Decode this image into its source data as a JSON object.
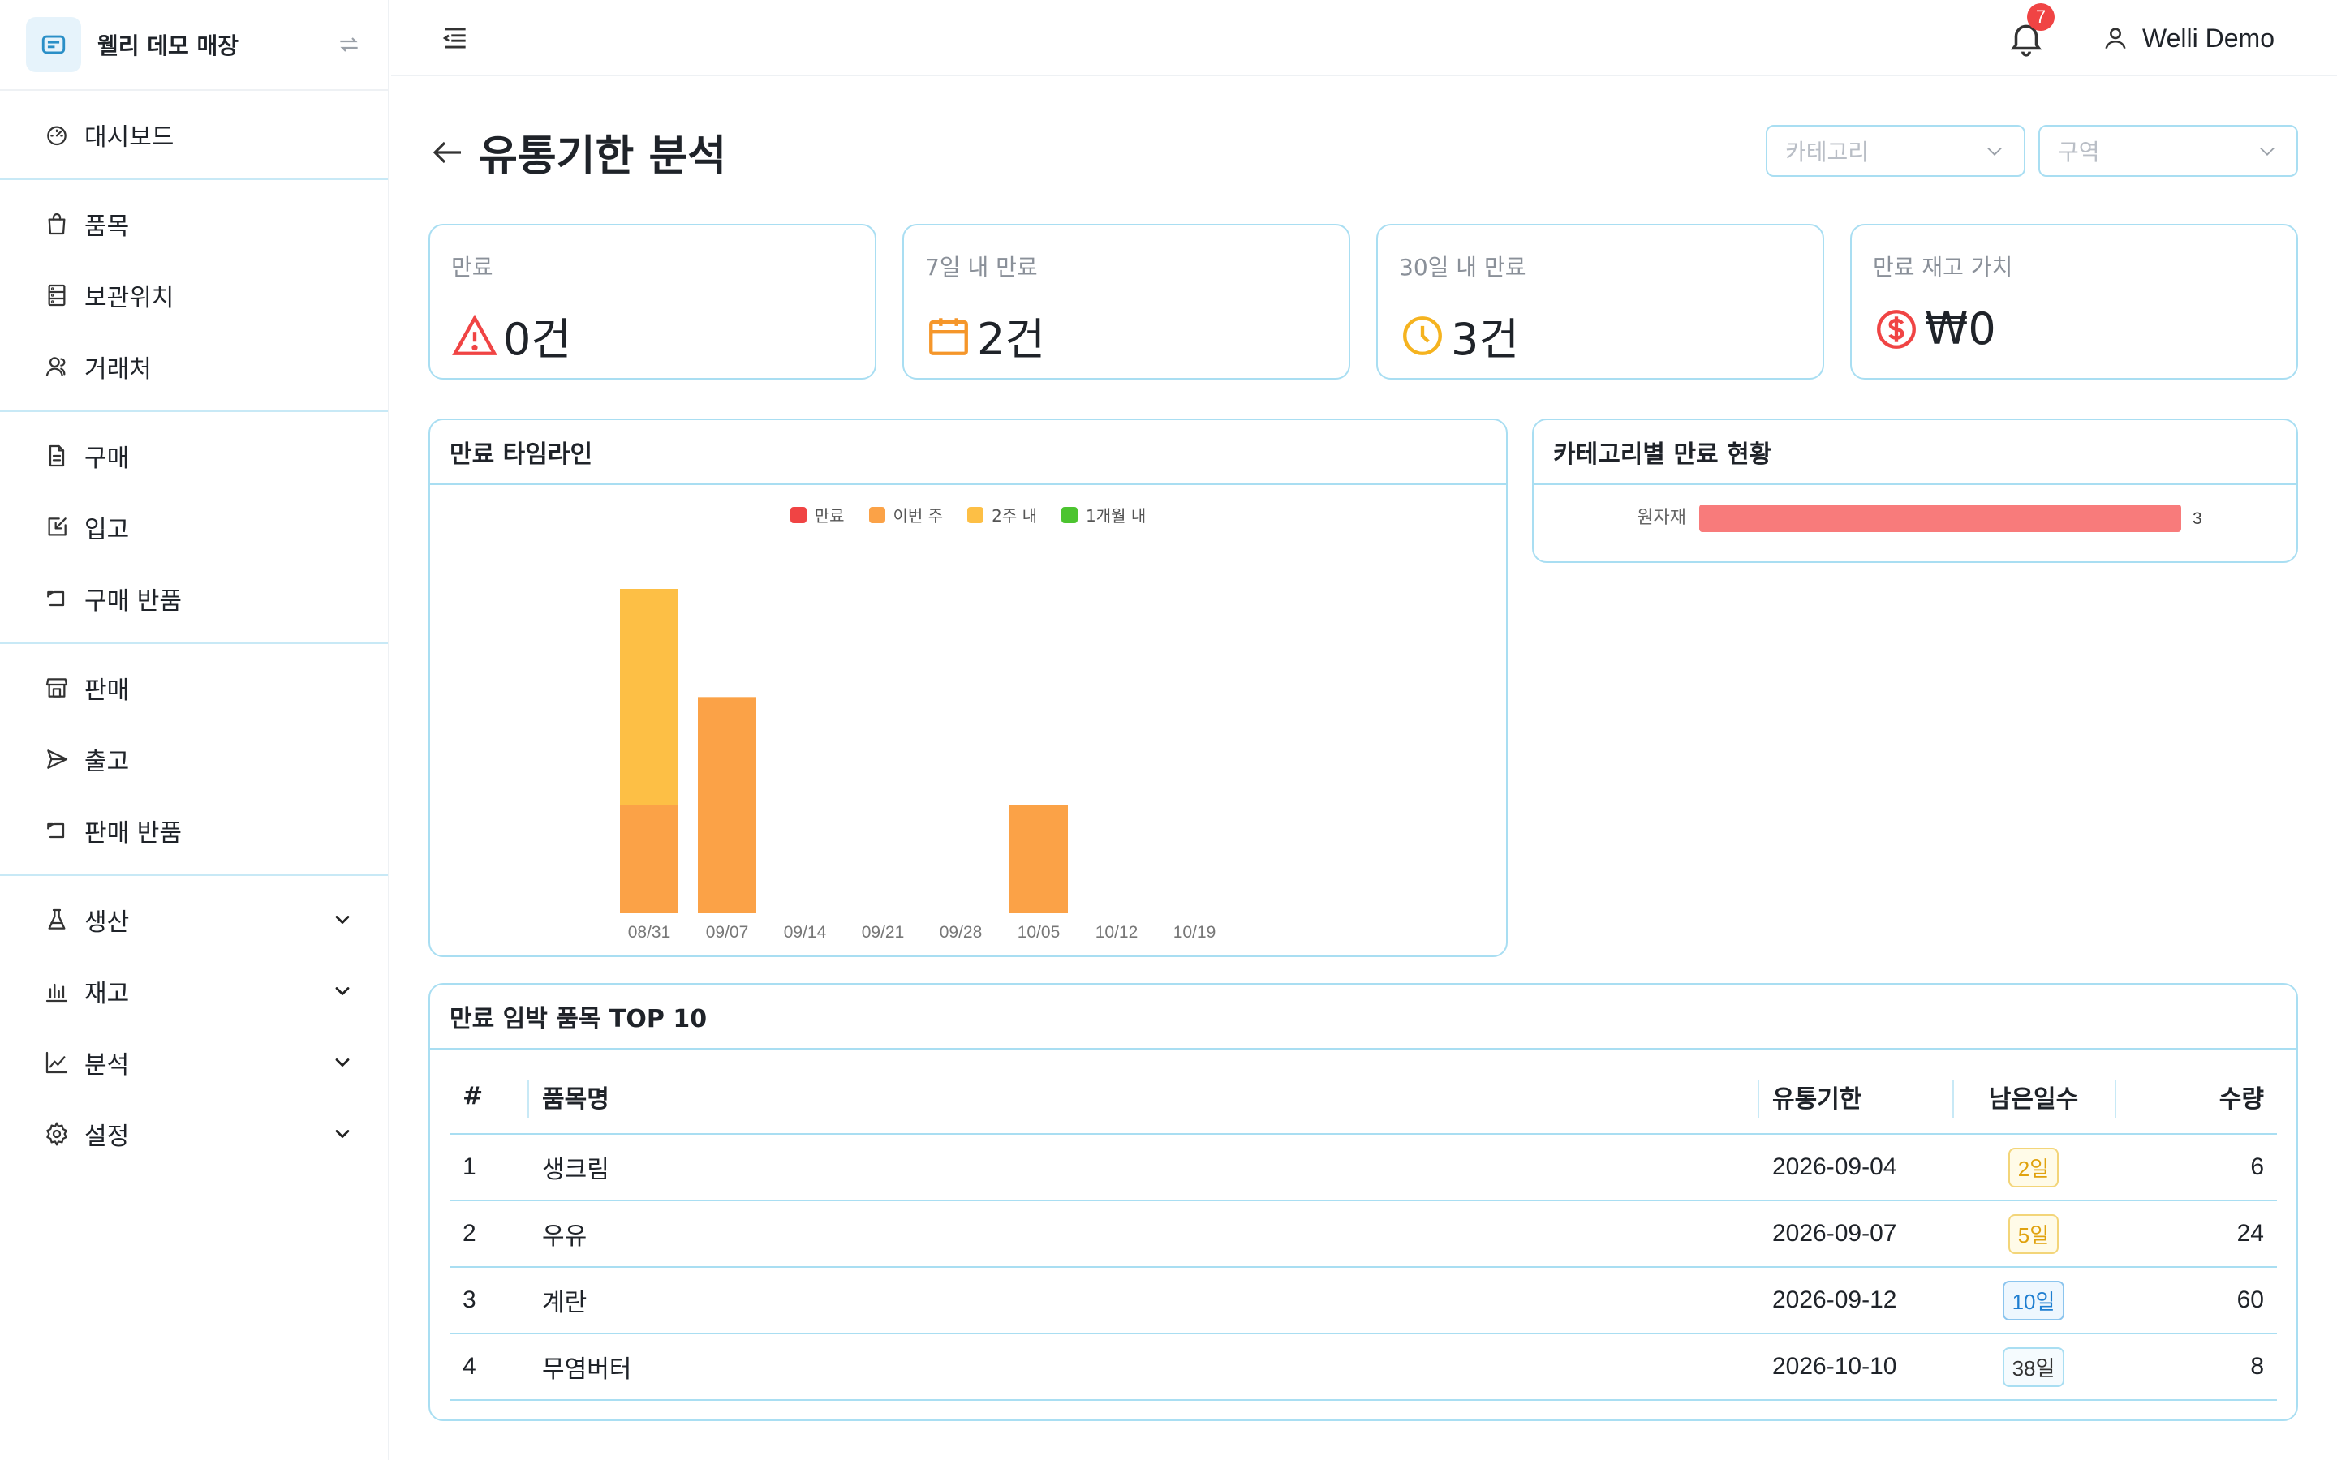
{
  "app": {
    "brand": "웰리 데모 매장"
  },
  "sidebar": {
    "groups": [
      [
        {
          "label": "대시보드",
          "icon": "dashboard-icon"
        }
      ],
      [
        {
          "label": "품목",
          "icon": "bag-icon"
        },
        {
          "label": "보관위치",
          "icon": "storage-icon"
        },
        {
          "label": "거래처",
          "icon": "partner-icon"
        }
      ],
      [
        {
          "label": "구매",
          "icon": "document-icon"
        },
        {
          "label": "입고",
          "icon": "inbound-icon"
        },
        {
          "label": "구매 반품",
          "icon": "return-icon"
        }
      ],
      [
        {
          "label": "판매",
          "icon": "store-icon"
        },
        {
          "label": "출고",
          "icon": "send-icon"
        },
        {
          "label": "판매 반품",
          "icon": "return-icon"
        }
      ],
      [
        {
          "label": "생산",
          "icon": "flask-icon"
        },
        {
          "label": "재고",
          "icon": "bar-chart-icon"
        },
        {
          "label": "분석",
          "icon": "line-chart-icon"
        },
        {
          "label": "설정",
          "icon": "gear-icon"
        }
      ]
    ]
  },
  "header": {
    "notification_count": "7",
    "user_name": "Welli Demo"
  },
  "page": {
    "title": "유통기한 분석",
    "filters": {
      "category_placeholder": "카테고리",
      "zone_placeholder": "구역"
    }
  },
  "stats": [
    {
      "label": "만료",
      "value": "0건",
      "color": "#f04444"
    },
    {
      "label": "7일 내 만료",
      "value": "2건",
      "color": "#f5962a"
    },
    {
      "label": "30일 내 만료",
      "value": "3건",
      "color": "#f5b31f"
    },
    {
      "label": "만료 재고 가치",
      "value": "₩0",
      "color": "#f04444"
    }
  ],
  "timeline": {
    "title": "만료 타임라인",
    "chart_data": {
      "type": "bar",
      "stacked": true,
      "categories": [
        "08/31",
        "09/07",
        "09/14",
        "09/21",
        "09/28",
        "10/05",
        "10/12",
        "10/19"
      ],
      "series": [
        {
          "name": "만료",
          "color": "#f04444",
          "values": [
            0,
            0,
            0,
            0,
            0,
            0,
            0,
            0
          ]
        },
        {
          "name": "이번 주",
          "color": "#fba247",
          "values": [
            1,
            2,
            0,
            0,
            0,
            1,
            0,
            0
          ]
        },
        {
          "name": "2주 내",
          "color": "#fdbf45",
          "values": [
            2,
            0,
            0,
            0,
            0,
            0,
            0,
            0
          ]
        },
        {
          "name": "1개월 내",
          "color": "#4cc42f",
          "values": [
            0,
            0,
            0,
            0,
            0,
            0,
            0,
            0
          ]
        }
      ],
      "ylim": [
        0,
        3
      ]
    }
  },
  "category": {
    "title": "카테고리별 만료 현황",
    "chart_data": {
      "type": "bar",
      "orientation": "horizontal",
      "categories": [
        "원자재"
      ],
      "values": [
        3
      ],
      "color": "#f87b7b"
    }
  },
  "top10": {
    "title": "만료 임박 품목 TOP 10",
    "columns": [
      "#",
      "품목명",
      "유통기한",
      "남은일수",
      "수량"
    ],
    "rows": [
      {
        "no": "1",
        "name": "생크림",
        "date": "2026-09-04",
        "days": "2일",
        "qty": "6",
        "level": "warn"
      },
      {
        "no": "2",
        "name": "우유",
        "date": "2026-09-07",
        "days": "5일",
        "qty": "24",
        "level": "warn"
      },
      {
        "no": "3",
        "name": "계란",
        "date": "2026-09-12",
        "days": "10일",
        "qty": "60",
        "level": "info"
      },
      {
        "no": "4",
        "name": "무염버터",
        "date": "2026-10-10",
        "days": "38일",
        "qty": "8",
        "level": "calm"
      }
    ]
  }
}
